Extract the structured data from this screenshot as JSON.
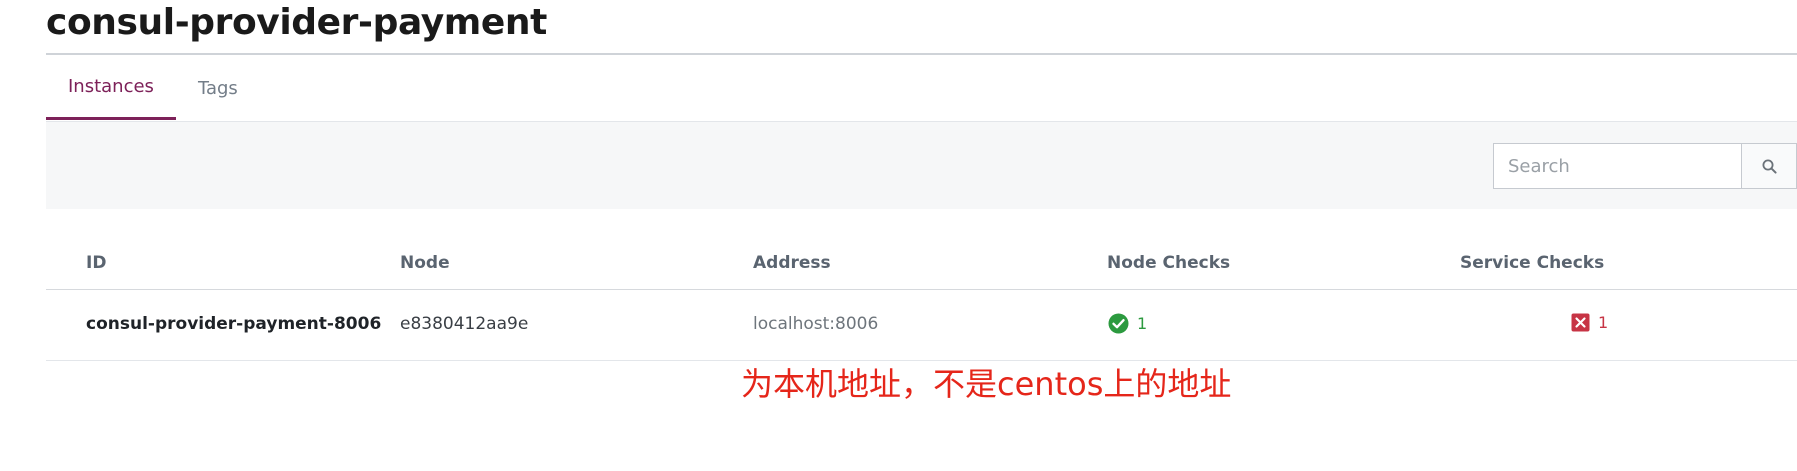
{
  "page": {
    "title": "consul-provider-payment"
  },
  "tabs": [
    {
      "label": "Instances",
      "active": true
    },
    {
      "label": "Tags",
      "active": false
    }
  ],
  "search": {
    "placeholder": "Search",
    "value": "",
    "button_icon": "search-icon"
  },
  "table": {
    "columns": [
      "ID",
      "Node",
      "Address",
      "Node Checks",
      "Service Checks"
    ],
    "rows": [
      {
        "id": "consul-provider-payment-8006",
        "node": "e8380412aa9e",
        "address": "localhost:8006",
        "node_checks": {
          "status": "passing",
          "icon": "check-circle-icon",
          "count": "1"
        },
        "service_checks": {
          "status": "critical",
          "icon": "x-square-icon",
          "count": "1"
        }
      }
    ]
  },
  "annotation": {
    "text": "为本机地址，不是centos上的地址",
    "color": "#e5261a"
  },
  "colors": {
    "accent": "#7d2159",
    "passing": "#2c9a3f",
    "critical": "#c73445",
    "filter_bar_bg": "#f6f7f8"
  }
}
